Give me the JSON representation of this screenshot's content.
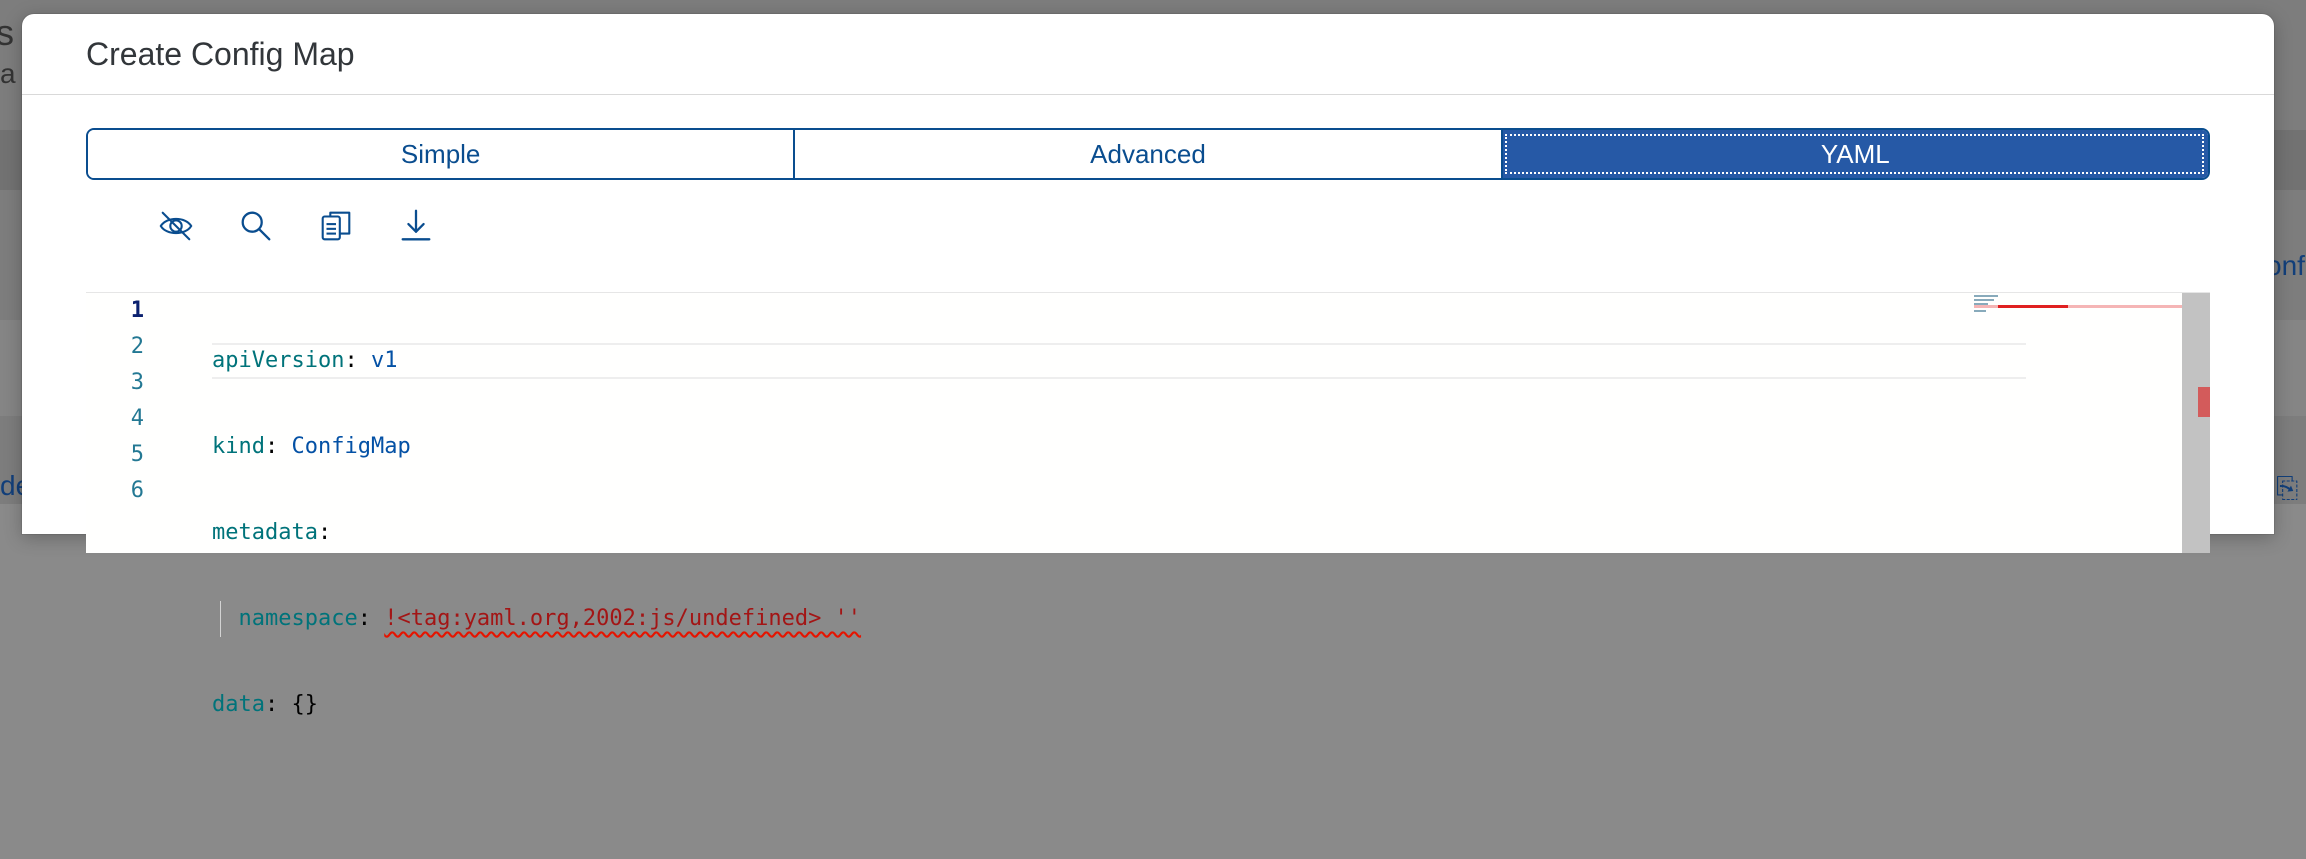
{
  "dialog": {
    "title": "Create Config Map"
  },
  "tabs": [
    {
      "label": "Simple",
      "active": false
    },
    {
      "label": "Advanced",
      "active": false
    },
    {
      "label": "YAML",
      "active": true
    }
  ],
  "toolbar": [
    {
      "name": "hide-icon"
    },
    {
      "name": "search-icon"
    },
    {
      "name": "copy-icon"
    },
    {
      "name": "download-icon"
    }
  ],
  "editor": {
    "line_numbers": [
      "1",
      "2",
      "3",
      "4",
      "5",
      "6"
    ],
    "lines": [
      {
        "key": "apiVersion",
        "sep": ": ",
        "value": "v1"
      },
      {
        "key": "kind",
        "sep": ": ",
        "value": "ConfigMap"
      },
      {
        "key": "metadata",
        "sep": ":",
        "value": ""
      },
      {
        "key": "namespace",
        "sep": ": ",
        "value": "!<tag:yaml.org,2002:js/undefined> ''"
      },
      {
        "key": "data",
        "sep": ": ",
        "value": "{}"
      },
      {
        "key": "",
        "sep": "",
        "value": ""
      }
    ]
  },
  "colors": {
    "accent": "#0a4d8f",
    "active_tab": "#2659a6",
    "error": "#e51400"
  }
}
